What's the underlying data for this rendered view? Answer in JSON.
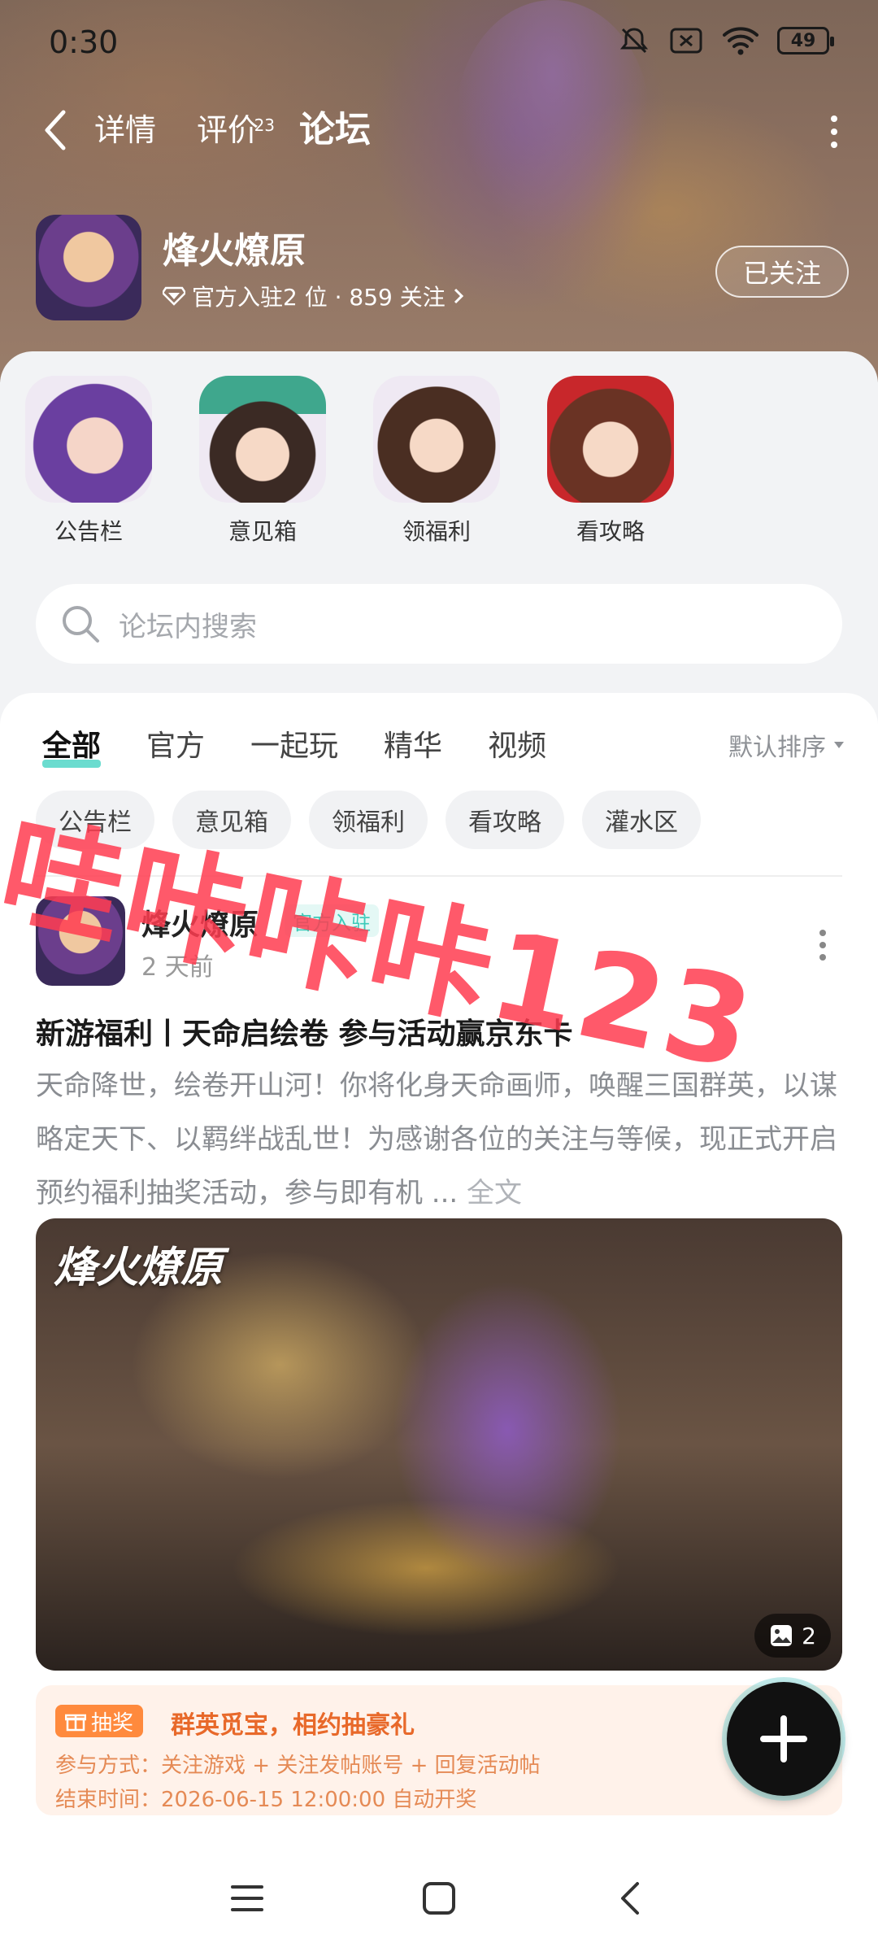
{
  "status_bar": {
    "time": "0:30",
    "battery": "49"
  },
  "nav": {
    "tabs": [
      {
        "label": "详情",
        "badge": ""
      },
      {
        "label": "评价",
        "badge": "23"
      },
      {
        "label": "论坛",
        "badge": ""
      }
    ],
    "active_tab": "论坛"
  },
  "game": {
    "name": "烽火燎原",
    "subtitle": "官方入驻2 位 · 859 关注",
    "follow_label": "已关注"
  },
  "shortcuts": [
    {
      "label": "公告栏",
      "icon": "girl-purple-hair-avatar"
    },
    {
      "label": "意见箱",
      "icon": "girl-green-hat-avatar"
    },
    {
      "label": "领福利",
      "icon": "girl-gold-crown-avatar"
    },
    {
      "label": "看攻略",
      "icon": "girl-red-hair-avatar"
    }
  ],
  "search": {
    "placeholder": "论坛内搜索"
  },
  "filters": [
    "全部",
    "官方",
    "一起玩",
    "精华",
    "视频"
  ],
  "active_filter": "全部",
  "sort_label": "默认排序",
  "chips": [
    "公告栏",
    "意见箱",
    "领福利",
    "看攻略",
    "灌水区"
  ],
  "post": {
    "author": "烽火燎原",
    "official_tag": "官方入驻",
    "time": "2 天前",
    "title": "新游福利丨天命启绘卷 参与活动赢京东卡",
    "body": "天命降世，绘卷开山河！你将化身天命画师，唤醒三国群英，以谋略定天下、以羁绊战乱世！为感谢各位的关注与等候，现正式开启预约福利抽奖活动，参与即有机 ...",
    "read_full": "全文",
    "image_logo": "烽火燎原",
    "image_count": "2",
    "lottery": {
      "tag": "抽奖",
      "title": "群英觅宝，相约抽豪礼",
      "method": "参与方式：关注游戏 + 关注发帖账号 + 回复活动帖",
      "end": "结束时间：2026-06-15 12:00:00 自动开奖"
    }
  },
  "watermark": "哇咔咔咔123",
  "colors": {
    "accent": "#46d3c3",
    "lottery": "#ff8a3d",
    "watermark": "#ff3c50"
  }
}
